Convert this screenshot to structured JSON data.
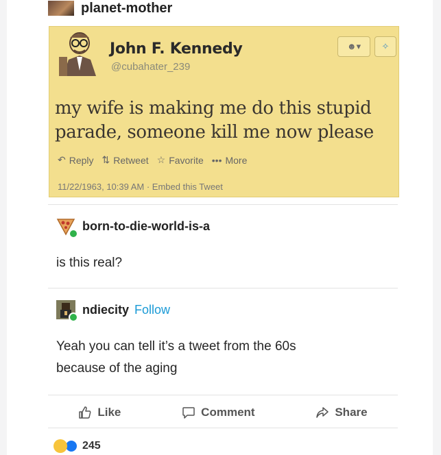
{
  "post": {
    "author": "planet-mother"
  },
  "tweet": {
    "name": "John F. Kennedy",
    "handle": "@cubahater_239",
    "text_line1": "my wife is making me do this stupid",
    "text_line2": "parade, someone kill me now please",
    "actions": [
      "Reply",
      "Retweet",
      "Favorite",
      "More"
    ],
    "meta": "11/22/1963, 10:39 AM · Embed this Tweet"
  },
  "comments": [
    {
      "username": "born-to-die-world-is-a",
      "lines": [
        "is this real?"
      ]
    },
    {
      "username": "ndiecity",
      "follow": "Follow",
      "lines": [
        "Yeah you can tell it’s a tweet from the 60s",
        "because of the aging"
      ]
    }
  ],
  "facebook": {
    "like": "Like",
    "comment": "Comment",
    "share": "Share",
    "reaction_count": "245"
  },
  "colors": {
    "tweet_bg": "#f3df8e",
    "follow": "#1a9ad6",
    "badge_green": "#2fb24a",
    "like_blue": "#1877f2"
  }
}
